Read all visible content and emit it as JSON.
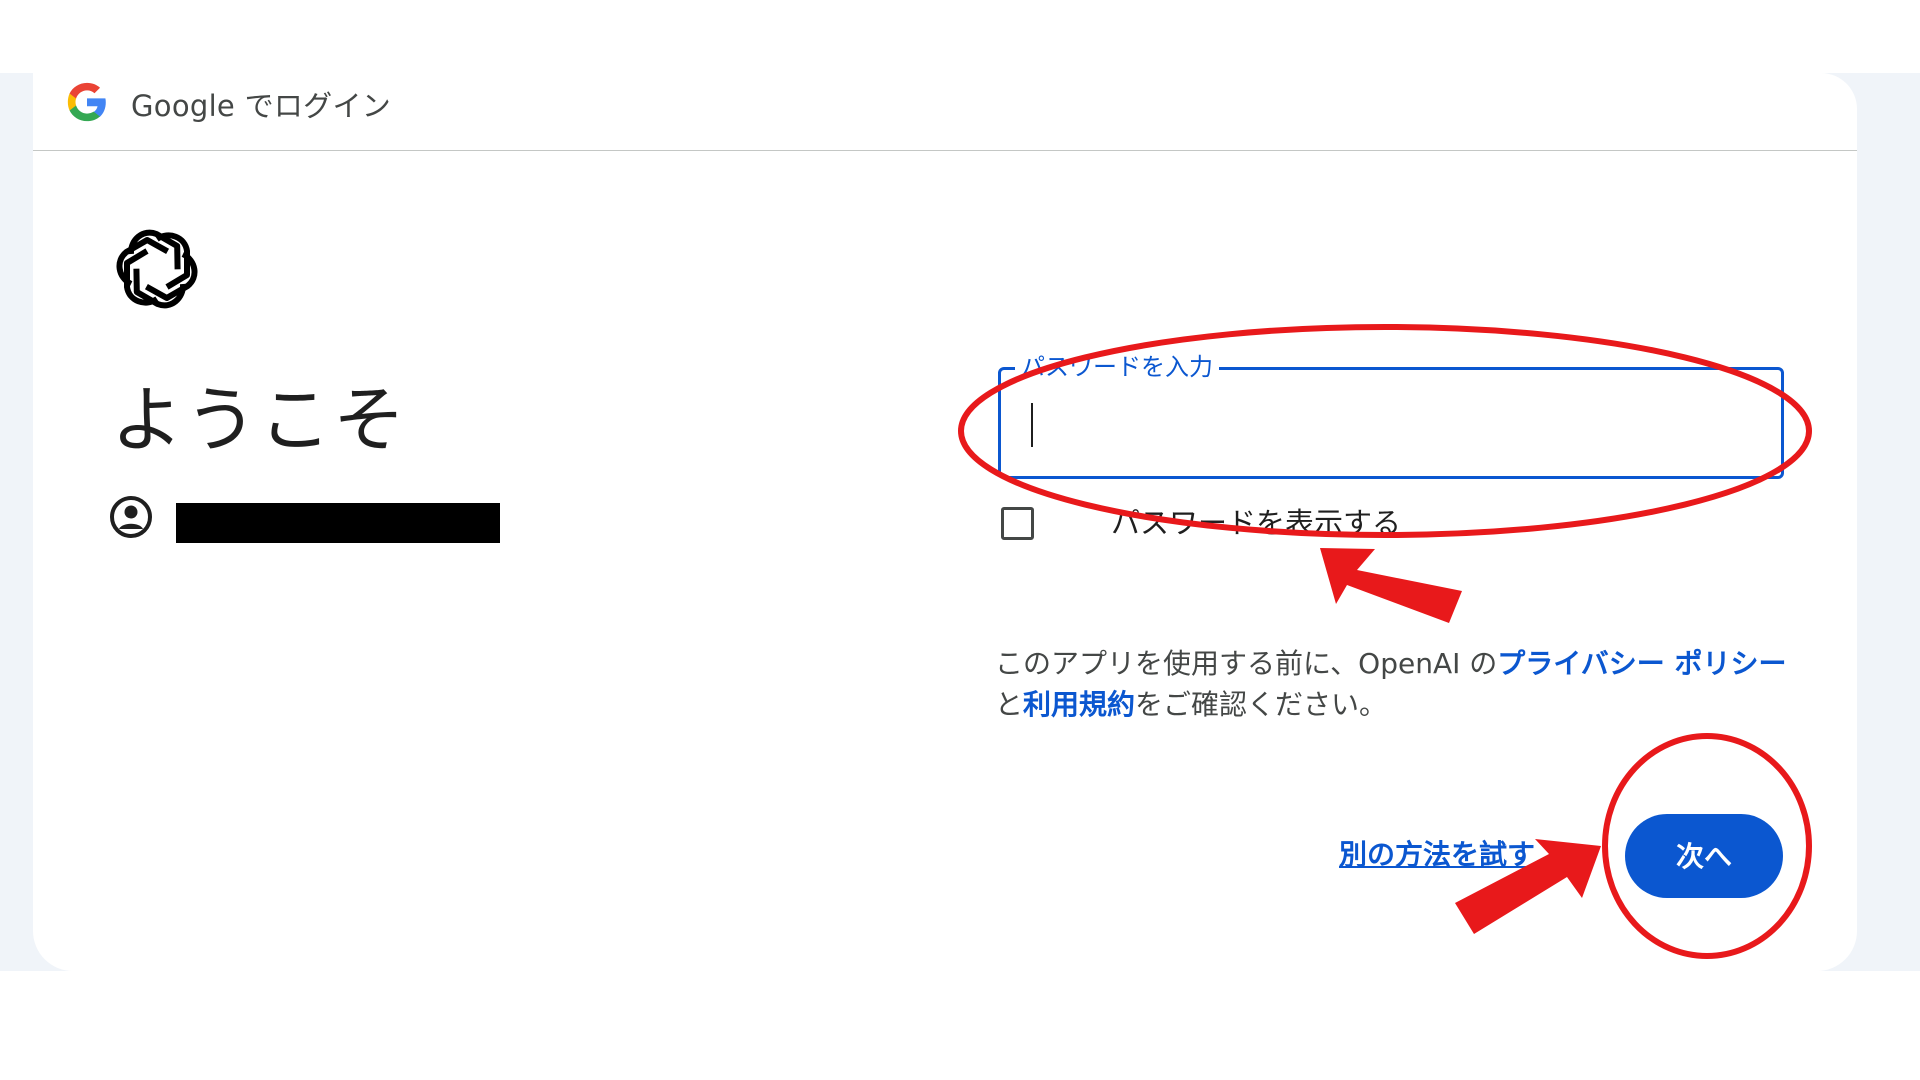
{
  "header": {
    "title": "Google でログイン",
    "logo_icon": "google-g-icon"
  },
  "app": {
    "logo_icon": "openai-logo-icon"
  },
  "welcome": {
    "heading": "ようこそ"
  },
  "account": {
    "icon": "account-circle-icon",
    "email": "(redacted)"
  },
  "password_field": {
    "label": "パスワードを入力",
    "value": ""
  },
  "show_password": {
    "label": "パスワードを表示する",
    "checked": false
  },
  "consent": {
    "prefix": "このアプリを使用する前に、OpenAI の",
    "privacy_link": "プライバシー ポリシー",
    "middle": "と",
    "terms_link": "利用規約",
    "suffix": "をご確認ください。"
  },
  "actions": {
    "try_another": "別の方法を試す",
    "next": "次へ"
  },
  "colors": {
    "accent": "#0b57d0",
    "annotation": "#e8191b"
  }
}
